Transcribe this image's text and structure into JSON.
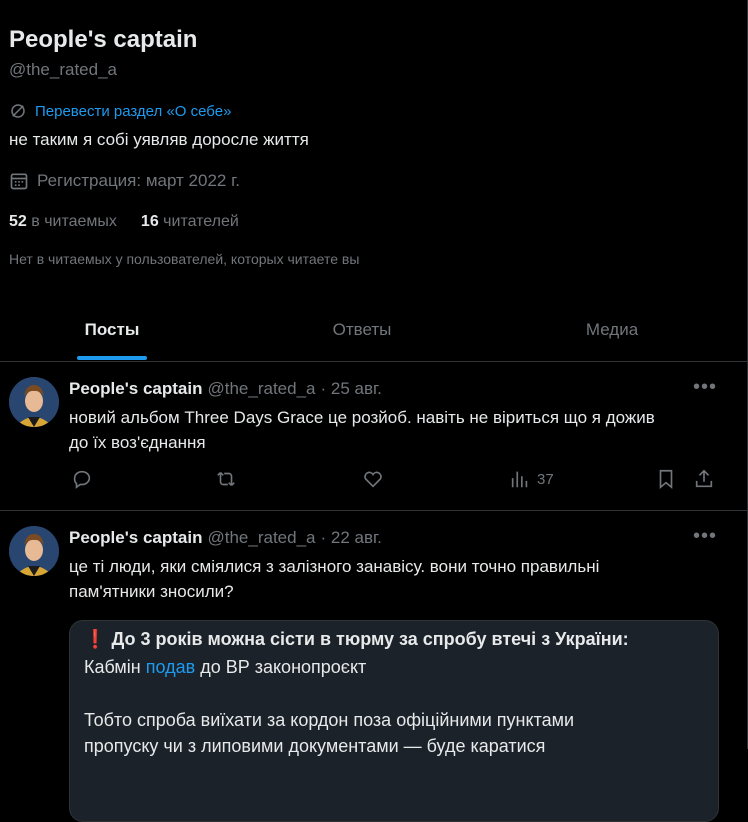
{
  "profile": {
    "name": "People's captain",
    "handle": "@the_rated_a",
    "translate_bio": "Перевести раздел «О себе»",
    "bio": "не таким я собі уявляв доросле життя",
    "joined": "Регистрация: март 2022 г.",
    "following_count": "52",
    "following_label": "в читаемых",
    "followers_count": "16",
    "followers_label": "читателей",
    "no_known_followers": "Нет в читаемых у пользователей, которых читаете вы"
  },
  "tabs": [
    {
      "label": "Посты",
      "active": true
    },
    {
      "label": "Ответы",
      "active": false
    },
    {
      "label": "Медиа",
      "active": false
    }
  ],
  "tweets": [
    {
      "author": "People's captain",
      "handle": "@the_rated_a",
      "date": "· 25 авг.",
      "text_line1": "новий альбом Three Days Grace це розйоб. навіть не віриться що я дожив",
      "text_line2": "до їх воз'єднання",
      "views": "37"
    },
    {
      "author": "People's captain",
      "handle": "@the_rated_a",
      "date": "· 22 авг.",
      "text_line1": "це ті люди, яки сміялися з залізного занавісу. вони точно правильні",
      "text_line2": "пам'ятники зносили?",
      "quote": {
        "emoji": "❗",
        "headline": "До 3 років можна сісти в тюрму за спробу втечі з України:",
        "line2_pre": "Кабмін ",
        "line2_link": "подав",
        "line2_post": " до ВР законопроєкт",
        "line3": "Тобто спроба виїхати за кордон поза офіційними пунктами",
        "line4": "пропуску чи з липовими документами — буде каратися"
      }
    }
  ],
  "icons": {
    "more": "more-icon",
    "reply": "reply-icon",
    "retweet": "retweet-icon",
    "like": "heart-icon",
    "views": "views-icon",
    "bookmark": "bookmark-icon",
    "share": "share-icon",
    "translate": "translate-icon",
    "calendar": "calendar-icon"
  },
  "colors": {
    "background": "#000000",
    "text": "#e7e9ea",
    "muted": "#71767b",
    "accent": "#1d9bf0",
    "border": "#2f3336"
  }
}
